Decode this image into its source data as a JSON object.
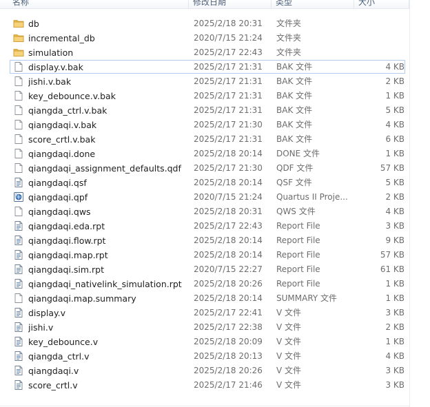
{
  "columns": {
    "name": "名称",
    "date": "修改日期",
    "type": "类型",
    "size": "大小"
  },
  "files": [
    {
      "name": "db",
      "date": "2025/2/18 20:31",
      "type": "文件夹",
      "size": "",
      "icon": "folder-icon",
      "selected": false
    },
    {
      "name": "incremental_db",
      "date": "2020/7/15 21:24",
      "type": "文件夹",
      "size": "",
      "icon": "folder-icon",
      "selected": false
    },
    {
      "name": "simulation",
      "date": "2025/2/17 22:43",
      "type": "文件夹",
      "size": "",
      "icon": "folder-icon",
      "selected": false
    },
    {
      "name": "display.v.bak",
      "date": "2025/2/17 21:31",
      "type": "BAK 文件",
      "size": "4 KB",
      "icon": "blank-file-icon",
      "selected": true
    },
    {
      "name": "jishi.v.bak",
      "date": "2025/2/17 21:31",
      "type": "BAK 文件",
      "size": "2 KB",
      "icon": "blank-file-icon",
      "selected": false
    },
    {
      "name": "key_debounce.v.bak",
      "date": "2025/2/17 21:31",
      "type": "BAK 文件",
      "size": "1 KB",
      "icon": "blank-file-icon",
      "selected": false
    },
    {
      "name": "qiangda_ctrl.v.bak",
      "date": "2025/2/17 21:31",
      "type": "BAK 文件",
      "size": "5 KB",
      "icon": "blank-file-icon",
      "selected": false
    },
    {
      "name": "qiangdaqi.v.bak",
      "date": "2025/2/17 21:30",
      "type": "BAK 文件",
      "size": "4 KB",
      "icon": "blank-file-icon",
      "selected": false
    },
    {
      "name": "score_crtl.v.bak",
      "date": "2025/2/17 21:31",
      "type": "BAK 文件",
      "size": "6 KB",
      "icon": "blank-file-icon",
      "selected": false
    },
    {
      "name": "qiangdaqi.done",
      "date": "2025/2/18 20:14",
      "type": "DONE 文件",
      "size": "1 KB",
      "icon": "blank-file-icon",
      "selected": false
    },
    {
      "name": "qiangdaqi_assignment_defaults.qdf",
      "date": "2025/2/17 21:30",
      "type": "QDF 文件",
      "size": "57 KB",
      "icon": "blank-file-icon",
      "selected": false
    },
    {
      "name": "qiangdaqi.qsf",
      "date": "2025/2/18 20:14",
      "type": "QSF 文件",
      "size": "5 KB",
      "icon": "text-file-icon",
      "selected": false
    },
    {
      "name": "qiangdaqi.qpf",
      "date": "2020/7/15 21:24",
      "type": "Quartus II Proje...",
      "size": "2 KB",
      "icon": "quartus-project-icon",
      "selected": false
    },
    {
      "name": "qiangdaqi.qws",
      "date": "2025/2/18 20:31",
      "type": "QWS 文件",
      "size": "4 KB",
      "icon": "blank-file-icon",
      "selected": false
    },
    {
      "name": "qiangdaqi.eda.rpt",
      "date": "2025/2/17 22:43",
      "type": "Report File",
      "size": "3 KB",
      "icon": "text-file-icon",
      "selected": false
    },
    {
      "name": "qiangdaqi.flow.rpt",
      "date": "2025/2/18 20:14",
      "type": "Report File",
      "size": "9 KB",
      "icon": "text-file-icon",
      "selected": false
    },
    {
      "name": "qiangdaqi.map.rpt",
      "date": "2025/2/18 20:14",
      "type": "Report File",
      "size": "57 KB",
      "icon": "text-file-icon",
      "selected": false
    },
    {
      "name": "qiangdaqi.sim.rpt",
      "date": "2020/7/15 22:27",
      "type": "Report File",
      "size": "61 KB",
      "icon": "text-file-icon",
      "selected": false
    },
    {
      "name": "qiangdaqi_nativelink_simulation.rpt",
      "date": "2025/2/18 20:26",
      "type": "Report File",
      "size": "1 KB",
      "icon": "text-file-icon",
      "selected": false
    },
    {
      "name": "qiangdaqi.map.summary",
      "date": "2025/2/18 20:14",
      "type": "SUMMARY 文件",
      "size": "1 KB",
      "icon": "blank-file-icon",
      "selected": false
    },
    {
      "name": "display.v",
      "date": "2025/2/17 22:41",
      "type": "V 文件",
      "size": "3 KB",
      "icon": "text-file-icon",
      "selected": false
    },
    {
      "name": "jishi.v",
      "date": "2025/2/17 22:38",
      "type": "V 文件",
      "size": "2 KB",
      "icon": "text-file-icon",
      "selected": false
    },
    {
      "name": "key_debounce.v",
      "date": "2025/2/18 20:09",
      "type": "V 文件",
      "size": "1 KB",
      "icon": "text-file-icon",
      "selected": false
    },
    {
      "name": "qiangda_ctrl.v",
      "date": "2025/2/18 20:13",
      "type": "V 文件",
      "size": "4 KB",
      "icon": "text-file-icon",
      "selected": false
    },
    {
      "name": "qiangdaqi.v",
      "date": "2025/2/18 20:26",
      "type": "V 文件",
      "size": "3 KB",
      "icon": "text-file-icon",
      "selected": false
    },
    {
      "name": "score_crtl.v",
      "date": "2025/2/17 21:46",
      "type": "V 文件",
      "size": "3 KB",
      "icon": "text-file-icon",
      "selected": false
    }
  ],
  "colors": {
    "folder": "#e8b84a",
    "selection_border": "#b2ccef",
    "header_text": "#4c607a",
    "secondary_text": "#6d6d6d"
  }
}
